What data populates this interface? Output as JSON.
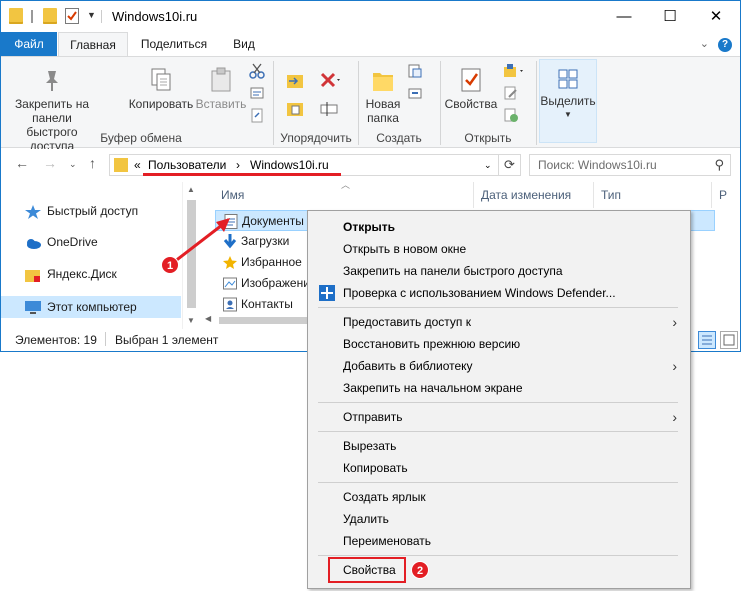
{
  "window": {
    "title": "Windows10i.ru",
    "controls": {
      "minimize": "—",
      "maximize": "☐",
      "close": "✕"
    }
  },
  "ribbon_tabs": [
    "Файл",
    "Главная",
    "Поделиться",
    "Вид"
  ],
  "ribbon": {
    "clipboard": {
      "pin_label_1": "Закрепить на панели",
      "pin_label_2": "быстрого доступа",
      "copy_label": "Копировать",
      "paste_label": "Вставить",
      "group_label": "Буфер обмена"
    },
    "organize": {
      "group_label": "Упорядочить"
    },
    "new": {
      "new_folder_label_1": "Новая",
      "new_folder_label_2": "папка",
      "group_label": "Создать"
    },
    "open": {
      "properties_label": "Свойства",
      "group_label": "Открыть"
    },
    "select": {
      "select_label": "Выделить"
    },
    "help": "?"
  },
  "address": {
    "prefix": "«",
    "crumbs": [
      "Пользователи",
      "Windows10i.ru"
    ],
    "separator": "›",
    "search_placeholder": "Поиск: Windows10i.ru"
  },
  "nav_pane": {
    "items": [
      "Быстрый доступ",
      "OneDrive",
      "Яндекс.Диск",
      "Этот компьютер"
    ]
  },
  "file_list": {
    "columns": [
      "Имя",
      "Дата изменения",
      "Тип",
      "Р"
    ],
    "rows": [
      "Документы",
      "Загрузки",
      "Избранное",
      "Изображения",
      "Контакты"
    ]
  },
  "status_bar": {
    "items_count": "Элементов: 19",
    "selected": "Выбран 1 элемент"
  },
  "context_menu": {
    "items": [
      "Открыть",
      "Открыть в новом окне",
      "Закрепить на панели быстрого доступа",
      "Проверка с использованием Windows Defender...",
      "Предоставить доступ к",
      "Восстановить прежнюю версию",
      "Добавить в библиотеку",
      "Закрепить на начальном экране",
      "Отправить",
      "Вырезать",
      "Копировать",
      "Создать ярлык",
      "Удалить",
      "Переименовать",
      "Свойства"
    ],
    "submenu_arrow": "›"
  },
  "annotations": {
    "badge_1": "1",
    "badge_2": "2"
  },
  "colors": {
    "accent": "#1979ca",
    "highlight_red": "#e31e24",
    "selection": "#cce8ff"
  },
  "icons": [
    "folder-icon",
    "checklist-icon",
    "pin-icon",
    "copy-icon",
    "paste-icon",
    "scissors-icon",
    "move-to-icon",
    "delete-icon",
    "new-folder-icon",
    "properties-icon",
    "select-icon",
    "star-icon",
    "cloud-icon",
    "computer-icon",
    "document-icon",
    "download-icon",
    "shield-icon"
  ]
}
